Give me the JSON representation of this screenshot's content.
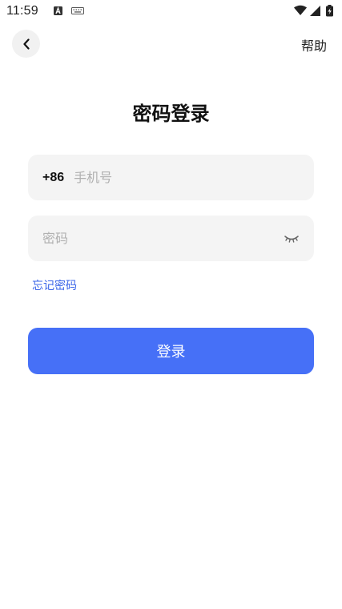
{
  "status_bar": {
    "time": "11:59",
    "notification_icons": [
      "a-notification-icon",
      "keyboard-icon"
    ],
    "right_icons": [
      "wifi-icon",
      "signal-icon",
      "battery-icon"
    ]
  },
  "header": {
    "back_icon": "chevron-left-icon",
    "help_label": "帮助"
  },
  "title": "密码登录",
  "phone_field": {
    "country_code": "+86",
    "placeholder": "手机号",
    "value": ""
  },
  "password_field": {
    "placeholder": "密码",
    "value": "",
    "toggle_icon": "eye-closed-icon"
  },
  "forgot_password_label": "忘记密码",
  "login_button_label": "登录",
  "colors": {
    "accent": "#4670f7",
    "link": "#3a64e8",
    "field_background": "#f4f4f4"
  }
}
